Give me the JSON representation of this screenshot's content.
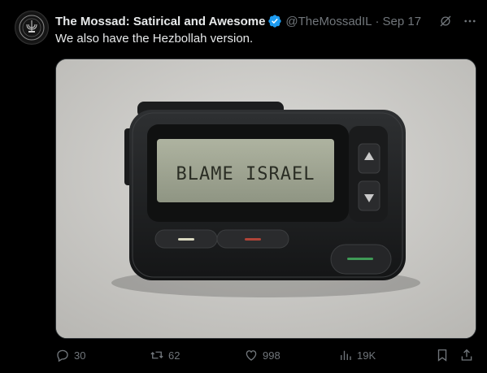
{
  "author": {
    "name": "The Mossad: Satirical and Awesome",
    "handle": "@TheMossadIL",
    "separator": "·",
    "date": "Sep 17"
  },
  "tweet": {
    "text": "We also have the Hezbollah version."
  },
  "media": {
    "screen_text": "BLAME ISRAEL"
  },
  "actions": {
    "replies": "30",
    "reposts": "62",
    "likes": "998",
    "views": "19K"
  },
  "icons": {
    "verified": "verified-badge-icon",
    "grok": "grok-icon",
    "more": "more-icon",
    "reply": "reply-icon",
    "repost": "repost-icon",
    "like": "heart-icon",
    "views": "views-icon",
    "bookmark": "bookmark-icon",
    "share": "share-icon"
  },
  "colors": {
    "background": "#000000",
    "text": "#e7e9ea",
    "muted": "#71767b",
    "verified": "#1d9bf0"
  }
}
